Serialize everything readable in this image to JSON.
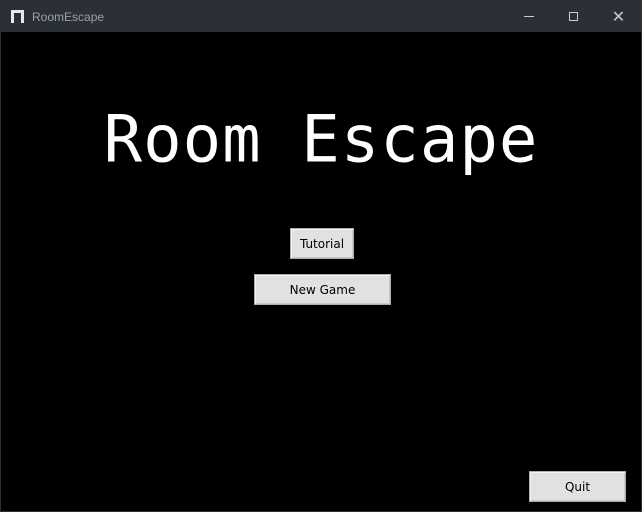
{
  "window": {
    "title": "RoomEscape",
    "icon": "app-icon",
    "controls": {
      "minimize_icon": "minimize-icon",
      "maximize_icon": "maximize-icon",
      "close_glyph": "✕"
    }
  },
  "main": {
    "title": "Room Escape",
    "buttons": {
      "tutorial": "Tutorial",
      "new_game": "New Game",
      "quit": "Quit"
    }
  },
  "colors": {
    "background": "#000000",
    "titlebar": "#2b3038",
    "button": "#e1e1e1",
    "title_text": "#ffffff"
  }
}
